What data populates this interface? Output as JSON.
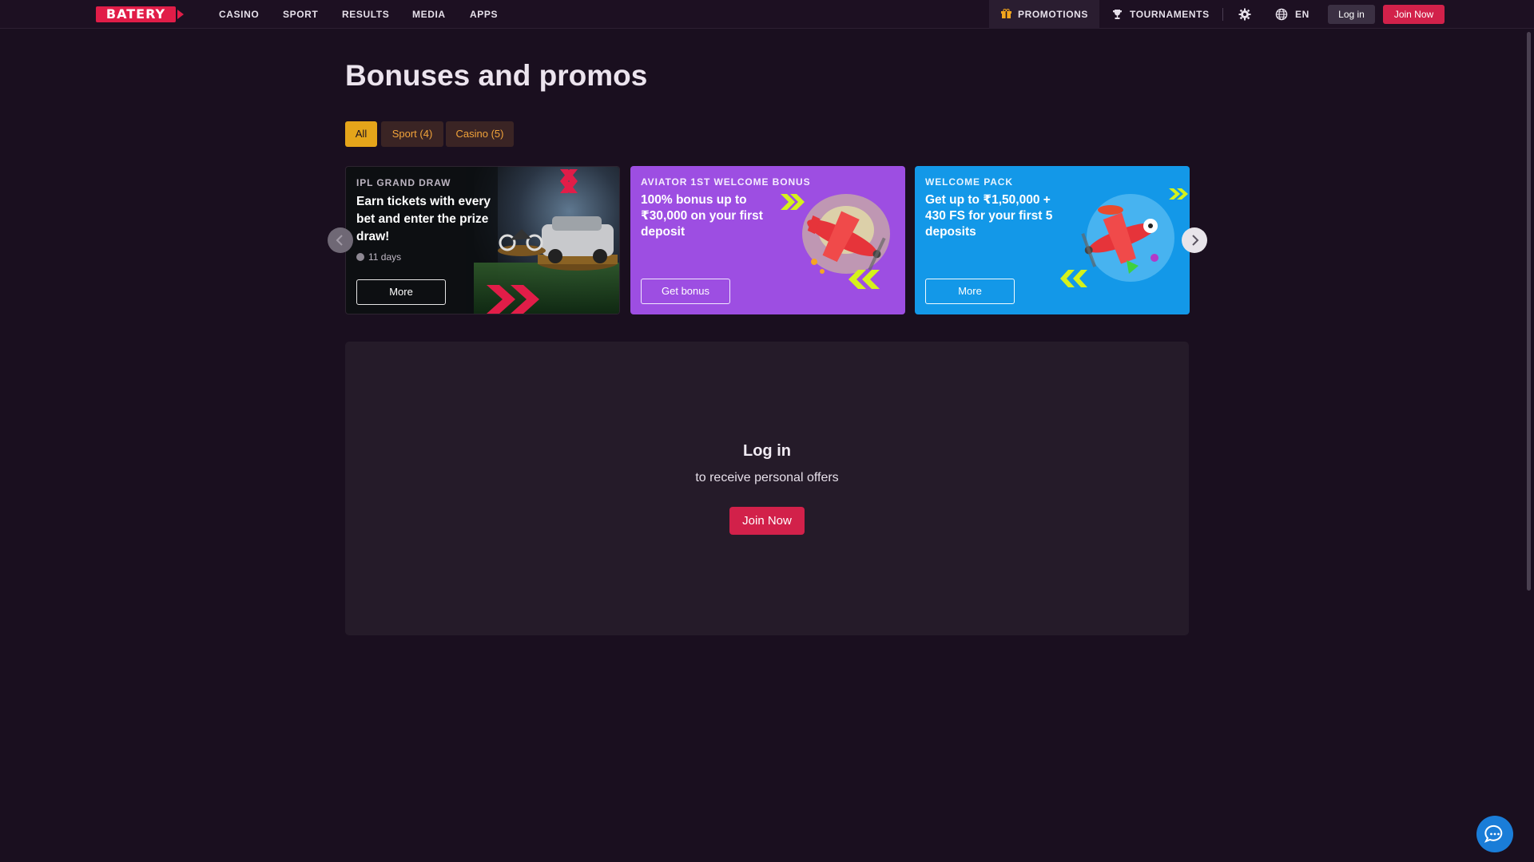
{
  "brand": {
    "logo_text": "BATERY",
    "accent": "#e11d48"
  },
  "nav": {
    "items": [
      "CASINO",
      "SPORT",
      "RESULTS",
      "MEDIA",
      "APPS"
    ]
  },
  "header": {
    "promotions": "PROMOTIONS",
    "tournaments": "TOURNAMENTS",
    "language": "EN",
    "login": "Log in",
    "join": "Join Now"
  },
  "page": {
    "title": "Bonuses and promos"
  },
  "filters": [
    {
      "label": "All",
      "active": true
    },
    {
      "label": "Sport (4)",
      "active": false
    },
    {
      "label": "Casino (5)",
      "active": false
    }
  ],
  "cards": [
    {
      "label": "IPL GRAND DRAW",
      "title": "Earn tickets with every bet and enter the prize draw!",
      "timer": "11 days",
      "cta": "More",
      "bg": "#0d0f12"
    },
    {
      "label": "AVIATOR 1ST WELCOME BONUS",
      "title": "100% bonus up to ₹30,000 on your first deposit",
      "cta": "Get bonus",
      "bg": "#9d4ee2"
    },
    {
      "label": "WELCOME PACK",
      "title": "Get up to ₹1,50,000 + 430 FS for your first 5 deposits",
      "cta": "More",
      "bg": "#1398e8"
    }
  ],
  "login_panel": {
    "title": "Log in",
    "subtitle": "to receive personal offers",
    "button": "Join Now"
  },
  "icons": {
    "gift": "gift-icon",
    "trophy": "trophy-icon",
    "settings": "gear-icon",
    "language": "globe-icon",
    "chat": "chat-icon",
    "prev": "chevron-left-icon",
    "next": "chevron-right-icon"
  }
}
